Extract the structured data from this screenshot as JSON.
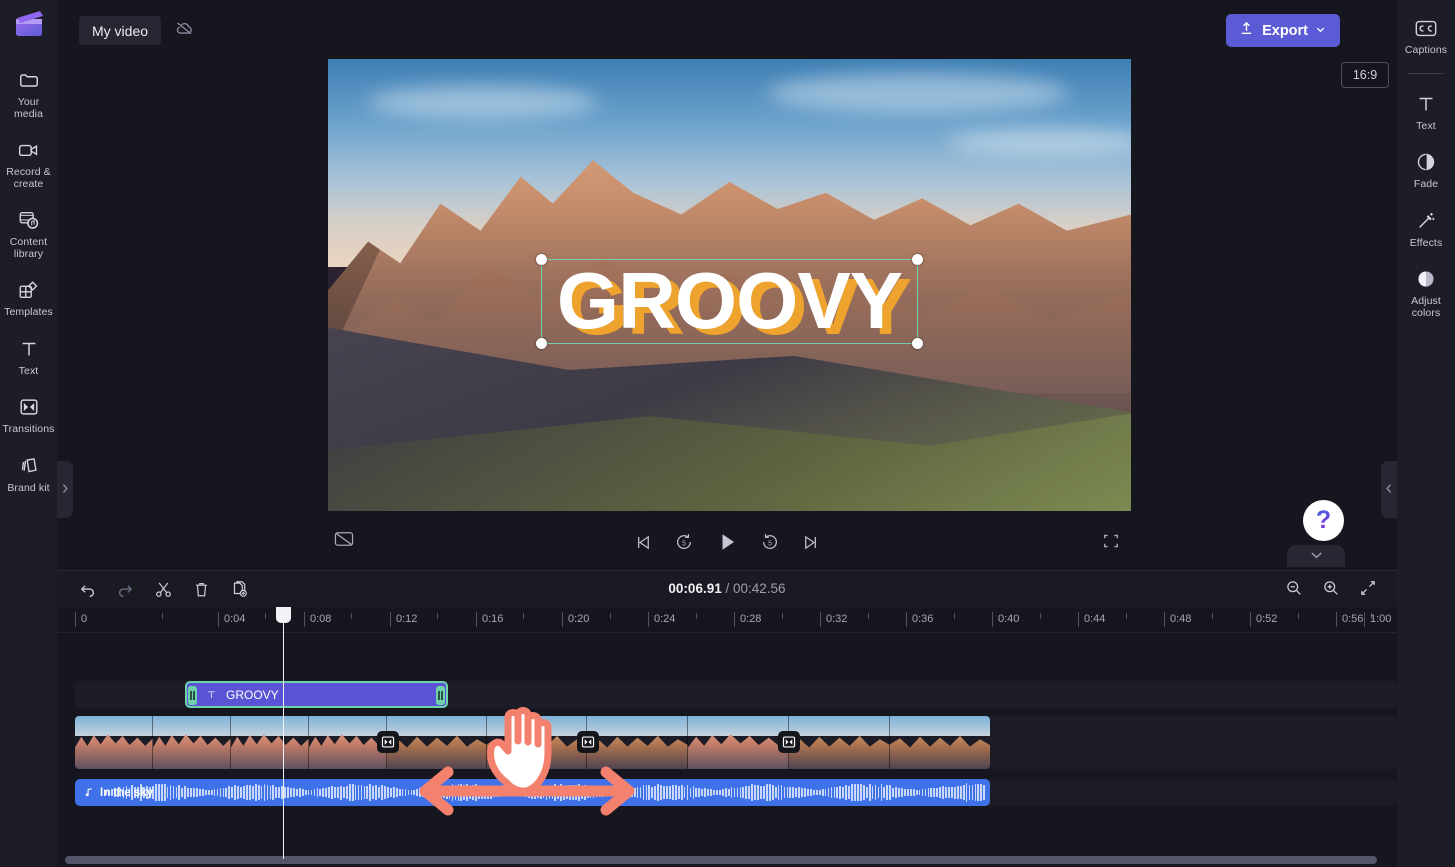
{
  "app": {
    "logo_icon": "clapperboard-icon",
    "accent_color": "#5b5bd6",
    "selection_color": "#6ed3ac",
    "annotation_color": "#f4806e"
  },
  "left_rail": {
    "items": [
      {
        "label": "Your media",
        "icon": "folder-icon"
      },
      {
        "label": "Record & create",
        "icon": "video-camera-icon"
      },
      {
        "label": "Content library",
        "icon": "content-library-icon"
      },
      {
        "label": "Templates",
        "icon": "templates-icon"
      },
      {
        "label": "Text",
        "icon": "text-t-icon"
      },
      {
        "label": "Transitions",
        "icon": "transitions-icon"
      },
      {
        "label": "Brand kit",
        "icon": "brand-kit-icon"
      }
    ]
  },
  "right_rail": {
    "items": [
      {
        "label": "Captions",
        "icon": "closed-captions-icon"
      },
      {
        "label": "Text",
        "icon": "text-t-icon"
      },
      {
        "label": "Fade",
        "icon": "fade-icon"
      },
      {
        "label": "Effects",
        "icon": "magic-wand-icon"
      },
      {
        "label": "Adjust colors",
        "icon": "adjust-colors-icon"
      }
    ]
  },
  "header": {
    "project_title": "My video",
    "cloud_icon": "cloud-off-icon",
    "export_label": "Export",
    "export_icon": "upload-icon",
    "export_chevron": "chevron-down-icon"
  },
  "preview": {
    "aspect_ratio": "16:9",
    "overlay_text": "GROOVY",
    "overlay_text_color": "#ffffff",
    "overlay_shadow_color": "#eda32e",
    "expand_left_icon": "chevron-right-icon",
    "expand_right_icon": "chevron-left-icon",
    "help_icon": "question-mark-icon",
    "collapse_icon": "chevron-down-icon"
  },
  "playback": {
    "captions_toggle_icon": "captions-off-icon",
    "previous_icon": "skip-previous-icon",
    "rewind_label": "5",
    "rewind_icon": "rewind-5-icon",
    "play_icon": "play-icon",
    "forward_label": "5",
    "forward_icon": "forward-5-icon",
    "next_icon": "skip-next-icon",
    "fullscreen_icon": "fullscreen-icon"
  },
  "timeline_toolbar": {
    "tools": [
      {
        "name": "undo",
        "icon": "undo-icon"
      },
      {
        "name": "redo",
        "icon": "redo-icon"
      },
      {
        "name": "split",
        "icon": "scissors-icon"
      },
      {
        "name": "delete",
        "icon": "trash-icon"
      },
      {
        "name": "duplicate",
        "icon": "duplicate-icon"
      }
    ],
    "current_time": "00:06.91",
    "time_separator": "/",
    "total_time": "00:42.56",
    "zoom_out_icon": "zoom-out-icon",
    "zoom_in_icon": "zoom-in-icon",
    "fit_icon": "fit-to-screen-icon"
  },
  "timeline": {
    "ruler_ticks": [
      "0",
      "0:04",
      "0:08",
      "0:12",
      "0:16",
      "0:20",
      "0:24",
      "0:28",
      "0:32",
      "0:36",
      "0:40",
      "0:44",
      "0:48",
      "0:52",
      "0:56",
      "1:00"
    ],
    "playhead_time": "00:06.91",
    "tracks": {
      "text": {
        "clip_label": "GROOVY",
        "clip_icon": "text-clip-icon",
        "selected": true,
        "color": "#5a53d6"
      },
      "video": {
        "transition_icon": "transitions-icon",
        "transition_count": 3
      },
      "audio": {
        "clip_label": "In the sky",
        "clip_icon": "music-note-icon",
        "color": "#3f72e8"
      }
    }
  },
  "annotations": {
    "cursor_icon": "hand-cursor-icon",
    "gesture_icon": "drag-horizontal-arrow-icon"
  }
}
